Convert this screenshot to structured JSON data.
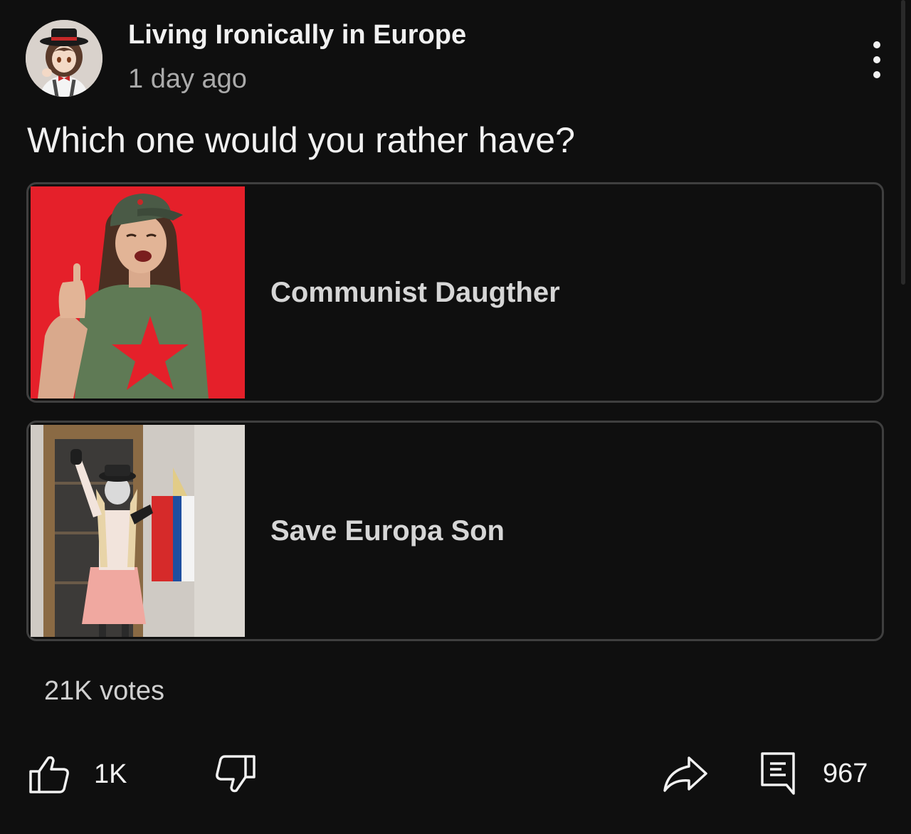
{
  "post": {
    "channel_name": "Living Ironically in Europe",
    "time_ago": "1 day ago",
    "question": "Which one would you rather have?"
  },
  "poll": {
    "options": [
      {
        "label": "Communist Daugther",
        "image": "woman-red-star-shirt-photo"
      },
      {
        "label": "Save Europa Son",
        "image": "costumed-person-flag-photo"
      }
    ],
    "vote_count": "21K votes"
  },
  "actions": {
    "like_count": "1K",
    "comment_count": "967"
  },
  "icons": {
    "menu": "more-vert-icon",
    "like": "thumb-up-icon",
    "dislike": "thumb-down-icon",
    "share": "share-arrow-icon",
    "comments": "comment-icon"
  },
  "colors": {
    "background": "#0f0f0f",
    "text_primary": "#f1f1f1",
    "text_secondary": "#aaaaaa",
    "option_border": "#3f3f3f"
  }
}
